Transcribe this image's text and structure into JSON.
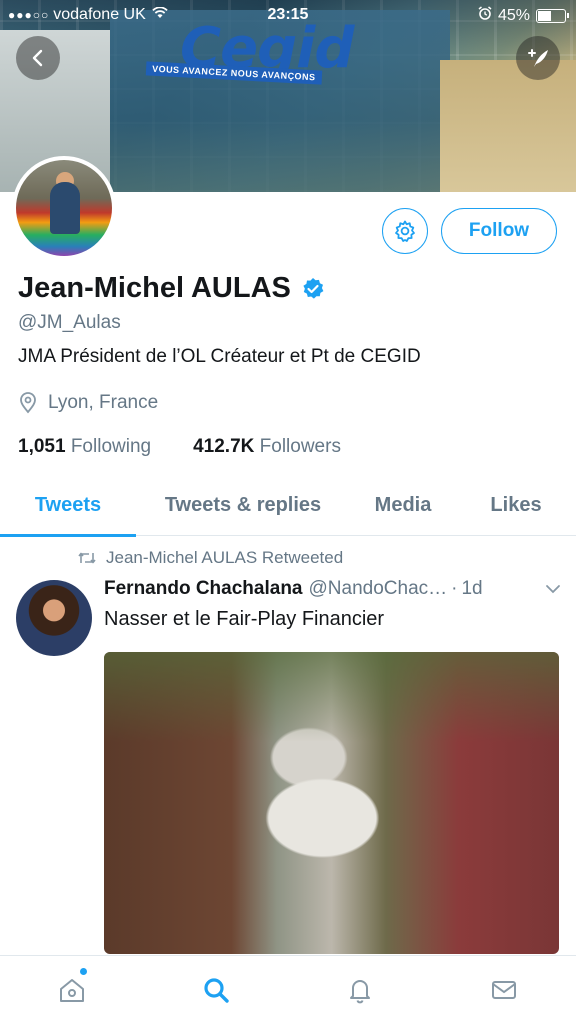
{
  "status_bar": {
    "signal": "●●●○○",
    "carrier": "vodafone UK",
    "time": "23:15",
    "battery": "45%",
    "battery_level": 0.45
  },
  "banner": {
    "logo_text": "Cegid",
    "tagline": "VOUS AVANCEZ NOUS AVANÇONS"
  },
  "profile": {
    "name": "Jean-Michel AULAS",
    "handle": "@JM_Aulas",
    "bio": "JMA Président de l’OL Créateur et Pt de CEGID",
    "location": "Lyon, France",
    "following_count": "1,051",
    "following_label": "Following",
    "followers_count": "412.7K",
    "followers_label": "Followers",
    "follow_button": "Follow"
  },
  "tabs": [
    {
      "label": "Tweets",
      "active": true
    },
    {
      "label": "Tweets & replies",
      "active": false
    },
    {
      "label": "Media",
      "active": false
    },
    {
      "label": "Likes",
      "active": false
    }
  ],
  "tweet": {
    "retweet_label": "Jean-Michel AULAS Retweeted",
    "author": "Fernando Chachalana",
    "author_handle": "@NandoChac…",
    "separator": "·",
    "time": "1d",
    "text": "Nasser et le Fair-Play Financier"
  },
  "colors": {
    "accent": "#1da1f2",
    "text": "#14171a",
    "muted": "#657786"
  },
  "icons": {
    "back": "back-arrow-icon",
    "compose": "compose-feather-icon",
    "gear": "gear-icon",
    "verified": "verified-badge-icon",
    "location": "location-pin-icon",
    "retweet": "retweet-icon",
    "chevron": "chevron-down-icon",
    "home": "home-icon",
    "search": "search-icon",
    "notifications": "bell-icon",
    "messages": "mail-icon"
  }
}
